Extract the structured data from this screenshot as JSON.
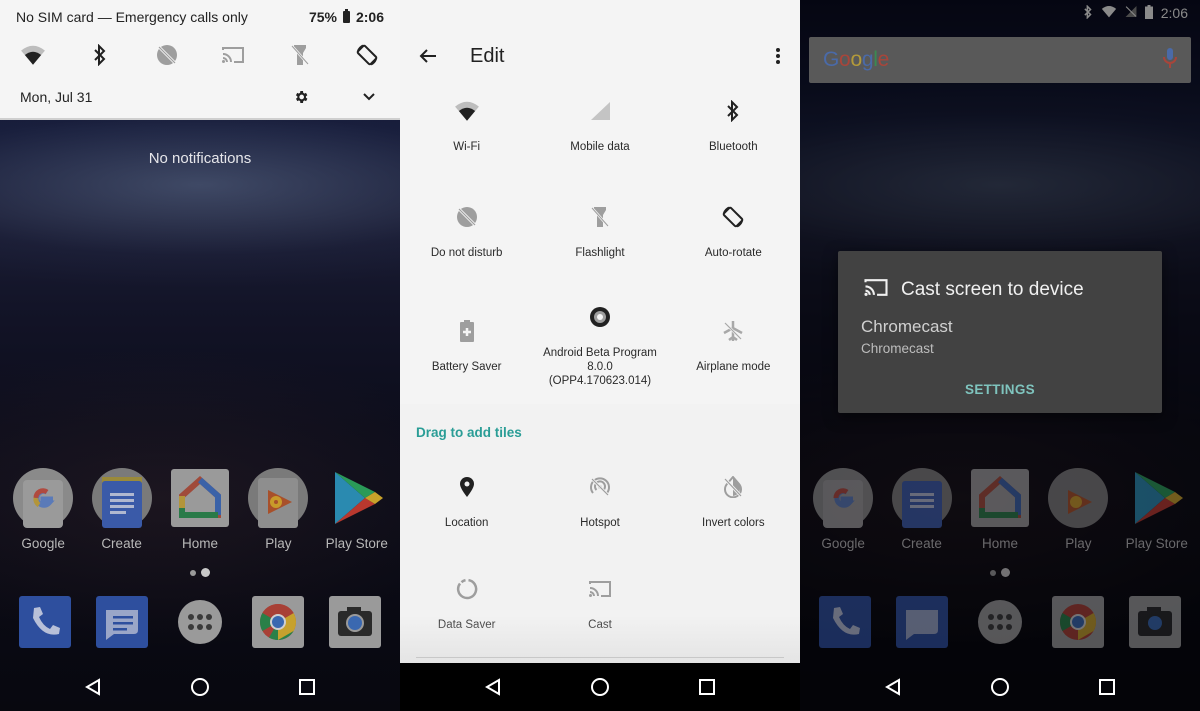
{
  "notification_shade": {
    "status_text": "No SIM card — Emergency calls only",
    "battery_percent": "75%",
    "time": "2:06",
    "quick_settings": [
      {
        "name": "wifi",
        "icon": "wifi-icon",
        "state": "on"
      },
      {
        "name": "bluetooth",
        "icon": "bluetooth-icon",
        "state": "on"
      },
      {
        "name": "do-not-disturb",
        "icon": "do-not-disturb-icon",
        "state": "off"
      },
      {
        "name": "cast",
        "icon": "cast-icon",
        "state": "off"
      },
      {
        "name": "flashlight",
        "icon": "flashlight-icon",
        "state": "off"
      },
      {
        "name": "auto-rotate",
        "icon": "auto-rotate-icon",
        "state": "on"
      }
    ],
    "date": "Mon, Jul 31",
    "settings_icon": "gear-icon",
    "expand_icon": "chevron-down-icon",
    "empty_message": "No notifications"
  },
  "home_screen": {
    "apps": [
      {
        "label": "Google",
        "icon": "google-app-icon"
      },
      {
        "label": "Create",
        "icon": "docs-folder-icon"
      },
      {
        "label": "Home",
        "icon": "google-home-icon"
      },
      {
        "label": "Play",
        "icon": "play-folder-icon"
      },
      {
        "label": "Play Store",
        "icon": "play-store-icon"
      }
    ],
    "dock": [
      {
        "name": "phone",
        "icon": "phone-icon"
      },
      {
        "name": "messages",
        "icon": "messages-icon"
      },
      {
        "name": "app-drawer",
        "icon": "app-drawer-icon"
      },
      {
        "name": "chrome",
        "icon": "chrome-icon"
      },
      {
        "name": "camera",
        "icon": "camera-icon"
      }
    ],
    "page_count": 2,
    "current_page": 2
  },
  "edit_tiles": {
    "title": "Edit",
    "back_icon": "back-arrow-icon",
    "more_icon": "more-vert-icon",
    "active_tiles": [
      {
        "label": "Wi-Fi",
        "icon": "wifi-icon"
      },
      {
        "label": "Mobile data",
        "icon": "signal-icon"
      },
      {
        "label": "Bluetooth",
        "icon": "bluetooth-icon"
      },
      {
        "label": "Do not disturb",
        "icon": "do-not-disturb-icon"
      },
      {
        "label": "Flashlight",
        "icon": "flashlight-icon"
      },
      {
        "label": "Auto-rotate",
        "icon": "auto-rotate-icon"
      },
      {
        "label": "Battery Saver",
        "icon": "battery-saver-icon"
      },
      {
        "label": "Android Beta Program\n8.0.0\n(OPP4.170623.014)",
        "icon": "beta-program-icon"
      },
      {
        "label": "Airplane mode",
        "icon": "airplane-icon"
      }
    ],
    "drag_header": "Drag to add tiles",
    "available_tiles": [
      {
        "label": "Location",
        "icon": "location-pin-icon"
      },
      {
        "label": "Hotspot",
        "icon": "hotspot-icon"
      },
      {
        "label": "Invert colors",
        "icon": "invert-colors-icon"
      },
      {
        "label": "Data Saver",
        "icon": "data-saver-icon"
      },
      {
        "label": "Cast",
        "icon": "cast-icon"
      }
    ]
  },
  "cast_screen": {
    "time": "2:06",
    "search_logo": "Google",
    "dialog_title": "Cast screen to device",
    "device_name": "Chromecast",
    "device_subtitle": "Chromecast",
    "settings_label": "SETTINGS"
  },
  "colors": {
    "accent_teal": "#2a9d96",
    "dialog_button": "#7fc4be",
    "shade_bg": "#f5f5f5",
    "dialog_bg": "#424242"
  }
}
